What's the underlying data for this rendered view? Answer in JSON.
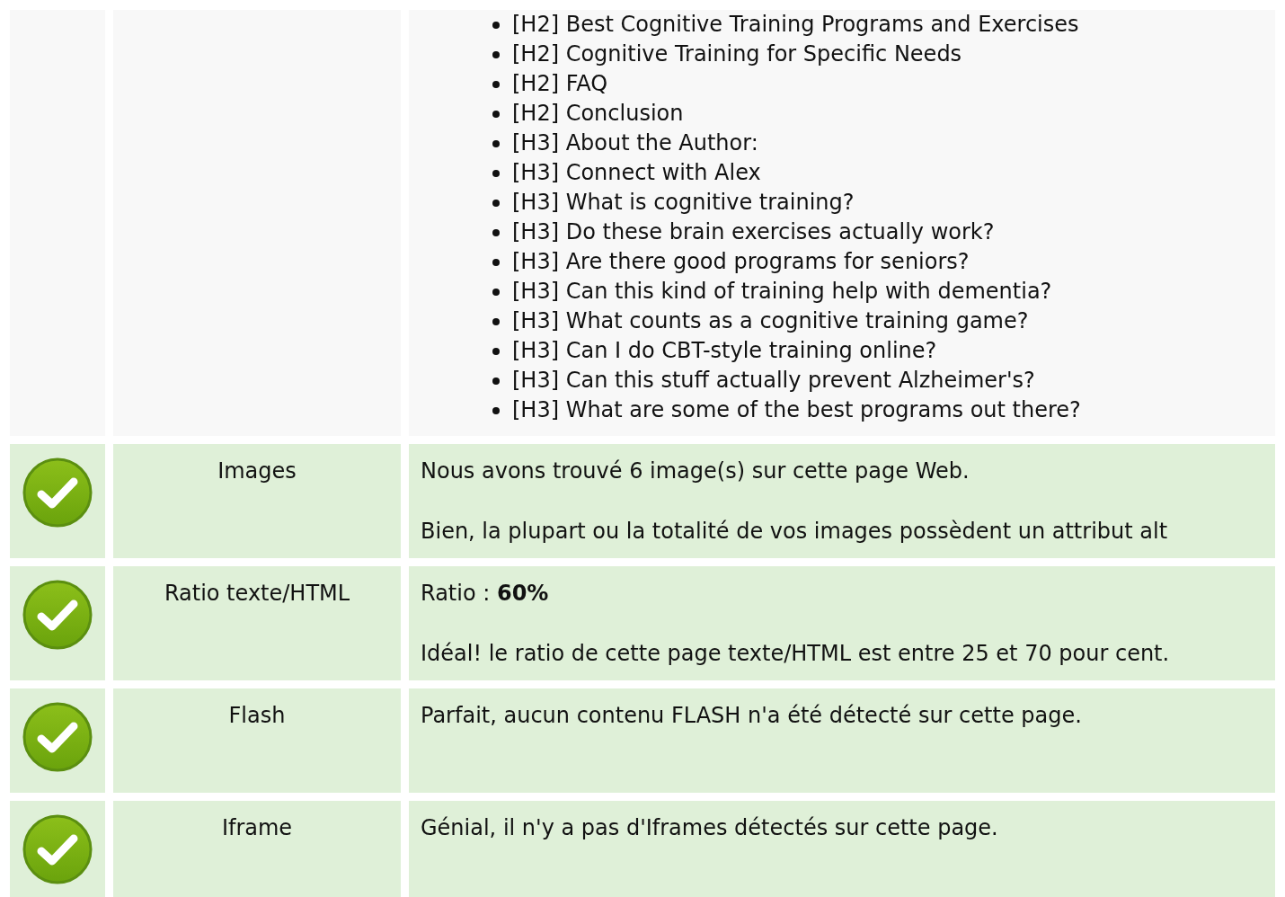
{
  "rows": [
    {
      "kind": "listing",
      "headings": [
        "[H2] Best Cognitive Training Programs and Exercises",
        "[H2] Cognitive Training for Specific Needs",
        "[H2] FAQ",
        "[H2] Conclusion",
        "[H3] About the Author:",
        "[H3] Connect with Alex",
        "[H3] What is cognitive training?",
        "[H3] Do these brain exercises actually work?",
        "[H3] Are there good programs for seniors?",
        "[H3] Can this kind of training help with dementia?",
        "[H3] What counts as a cognitive training game?",
        "[H3] Can I do CBT-style training online?",
        "[H3] Can this stuff actually prevent Alzheimer's?",
        "[H3] What are some of the best programs out there?"
      ]
    },
    {
      "kind": "pass",
      "label": "Images",
      "paragraphs": [
        "Nous avons trouvé 6 image(s) sur cette page Web.",
        "Bien, la plupart ou la totalité de vos images possèdent un attribut alt"
      ]
    },
    {
      "kind": "pass",
      "label": "Ratio texte/HTML",
      "paragraphs": [
        "Ratio : **60%**",
        "Idéal! le ratio de cette page texte/HTML est entre 25 et 70 pour cent."
      ]
    },
    {
      "kind": "pass",
      "label": "Flash",
      "paragraphs": [
        "Parfait, aucun contenu FLASH n'a été détecté sur cette page."
      ]
    },
    {
      "kind": "pass",
      "label": "Iframe",
      "paragraphs": [
        "Génial, il n'y a pas d'Iframes détectés sur cette page."
      ]
    }
  ]
}
